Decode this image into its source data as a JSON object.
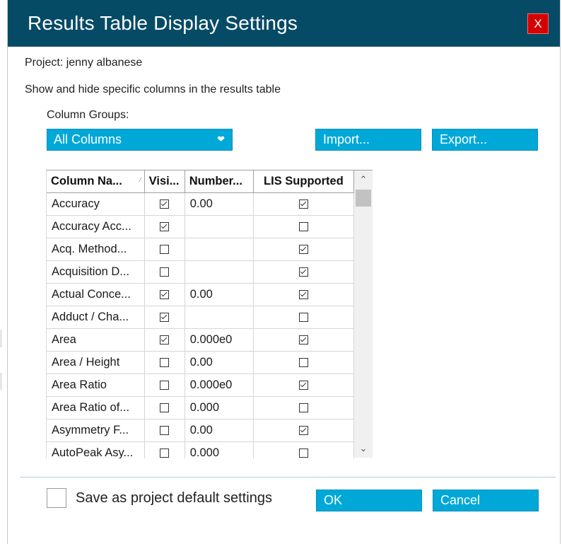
{
  "dialog": {
    "title": "Results Table Display Settings",
    "close_label": "X",
    "project_text": "Project: jenny albanese",
    "description": "Show and hide specific columns in the results table",
    "column_groups_label": "Column Groups:",
    "column_groups_selected": "All Columns",
    "import_label": "Import...",
    "export_label": "Export..."
  },
  "table": {
    "headers": [
      "Column Na...",
      "Visi...",
      "Number...",
      "LIS Supported"
    ],
    "rows": [
      {
        "name": "Accuracy",
        "visible": true,
        "number": "0.00",
        "lis": true
      },
      {
        "name": "Accuracy  Acc...",
        "visible": true,
        "number": "",
        "lis": false
      },
      {
        "name": "Acq.  Method...",
        "visible": false,
        "number": "",
        "lis": true
      },
      {
        "name": "Acquisition  D...",
        "visible": false,
        "number": "",
        "lis": true
      },
      {
        "name": "Actual  Conce...",
        "visible": true,
        "number": "0.00",
        "lis": true
      },
      {
        "name": "Adduct / Cha...",
        "visible": true,
        "number": "",
        "lis": false
      },
      {
        "name": "Area",
        "visible": true,
        "number": "0.000e0",
        "lis": true
      },
      {
        "name": "Area / Height",
        "visible": false,
        "number": "0.00",
        "lis": false
      },
      {
        "name": "Area Ratio",
        "visible": false,
        "number": "0.000e0",
        "lis": true
      },
      {
        "name": "Area Ratio of...",
        "visible": false,
        "number": "0.000",
        "lis": false
      },
      {
        "name": "Asymmetry F...",
        "visible": false,
        "number": "0.00",
        "lis": true
      },
      {
        "name": "AutoPeak Asy...",
        "visible": false,
        "number": "0.000",
        "lis": false
      }
    ]
  },
  "footer": {
    "save_default_label": "Save as project default settings",
    "save_default_checked": false,
    "ok_label": "OK",
    "cancel_label": "Cancel"
  },
  "colors": {
    "titlebar": "#064b66",
    "accent": "#00a8d8",
    "close": "#d40000"
  }
}
